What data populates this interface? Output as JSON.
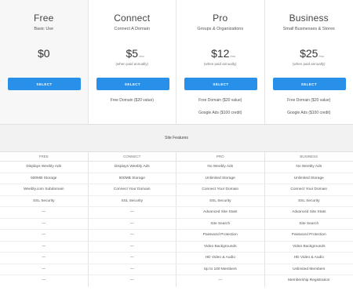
{
  "plans": [
    {
      "name": "Free",
      "subtitle": "Basic Use",
      "price": "$0",
      "per": "",
      "note": "",
      "select_label": "SELECT",
      "perks": [
        "",
        ""
      ]
    },
    {
      "name": "Connect",
      "subtitle": "Connect A Domain",
      "price": "$5",
      "per": "/mo",
      "note": "(when paid annually)",
      "select_label": "SELECT",
      "perks": [
        "Free Domain ($20 value)",
        ""
      ]
    },
    {
      "name": "Pro",
      "subtitle": "Groups & Organizations",
      "price": "$12",
      "per": "/mo",
      "note": "(when paid annually)",
      "select_label": "SELECT",
      "perks": [
        "Free Domain ($20 value)",
        "Google Ads ($100 credit)"
      ]
    },
    {
      "name": "Business",
      "subtitle": "Small Businesses & Stores",
      "price": "$25",
      "per": "/mo",
      "note": "(when paid annually)",
      "select_label": "SELECT",
      "perks": [
        "Free Domain ($20 value)",
        "Google Ads ($100 credit)"
      ]
    }
  ],
  "features": {
    "title": "Site Features",
    "columns": [
      "FREE",
      "CONNECT",
      "PRO",
      "BUSINESS"
    ],
    "rows": [
      [
        "Displays Weebly Ads",
        "Displays Weebly Ads",
        "No Weebly Ads",
        "No Weebly Ads"
      ],
      [
        "500MB Storage",
        "500MB Storage",
        "Unlimited Storage",
        "Unlimited Storage"
      ],
      [
        "Weebly.com Subdomain",
        "Connect Your Domain",
        "Connect Your Domain",
        "Connect Your Domain"
      ],
      [
        "SSL Security",
        "SSL Security",
        "SSL Security",
        "SSL Security"
      ],
      [
        "—",
        "—",
        "Advanced Site Stats",
        "Advanced Site Stats"
      ],
      [
        "—",
        "—",
        "Site Search",
        "Site Search"
      ],
      [
        "—",
        "—",
        "Password Protection",
        "Password Protection"
      ],
      [
        "—",
        "—",
        "Video Backgrounds",
        "Video Backgrounds"
      ],
      [
        "—",
        "—",
        "HD Video & Audio",
        "HD Video & Audio"
      ],
      [
        "—",
        "—",
        "Up to 100 Members",
        "Unlimited Members"
      ],
      [
        "—",
        "—",
        "—",
        "Membership Registration"
      ]
    ]
  }
}
